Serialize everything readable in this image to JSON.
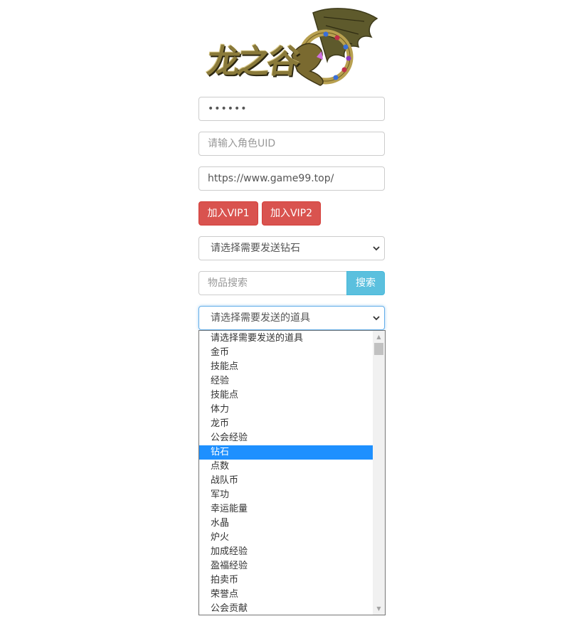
{
  "logo": {
    "text": "龙之谷",
    "colors": {
      "text": "#8a7a3a",
      "wing": "#5e5a2c",
      "ring": "#c0a850"
    }
  },
  "form": {
    "password_value": "••••••",
    "uid_placeholder": "请输入角色UID",
    "url_value": "https://www.game99.top/"
  },
  "vip_buttons": {
    "vip1_label": "加入VIP1",
    "vip2_label": "加入VIP2",
    "color": "#d9534f"
  },
  "currency_select": {
    "selected": "请选择需要发送钻石"
  },
  "item_search": {
    "placeholder": "物品搜索",
    "button_label": "搜索",
    "button_color": "#5bc0de"
  },
  "item_select": {
    "selected": "请选择需要发送的道具",
    "highlighted": "钻石",
    "options": [
      "请选择需要发送的道具",
      "金币",
      "技能点",
      "经验",
      "技能点",
      "体力",
      "龙币",
      "公会经验",
      "钻石",
      "点数",
      "战队币",
      "军功",
      "幸运能量",
      "水晶",
      "炉火",
      "加成经验",
      "盈福经验",
      "拍卖币",
      "荣誉点",
      "公会贡献"
    ]
  }
}
